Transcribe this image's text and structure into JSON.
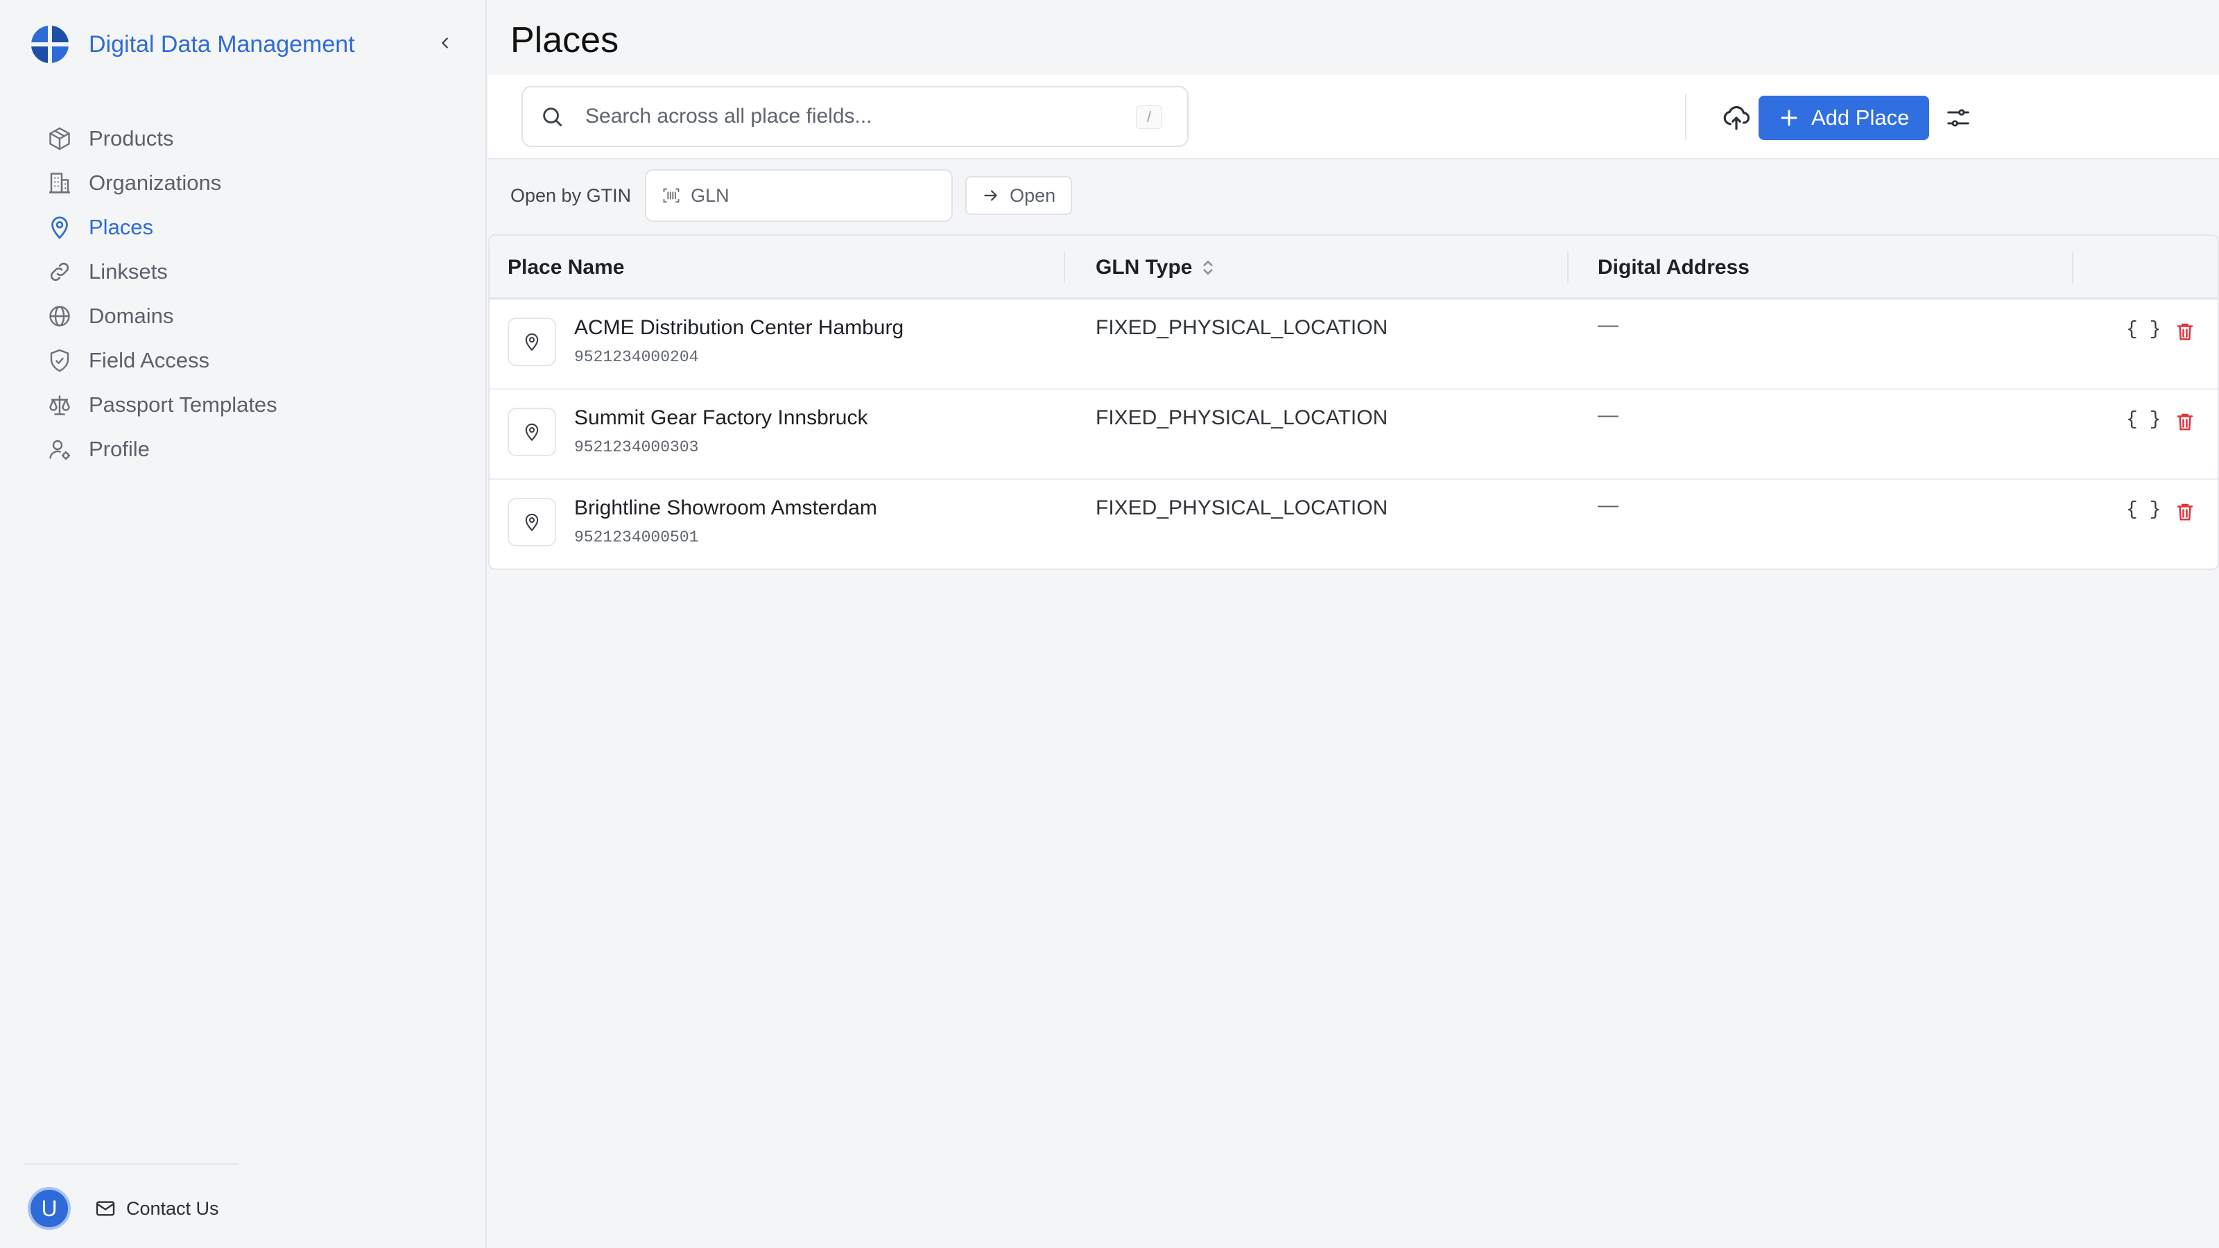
{
  "app": {
    "title": "Digital Data Management"
  },
  "sidebar": {
    "items": [
      {
        "label": "Products",
        "icon": "box-icon",
        "active": false
      },
      {
        "label": "Organizations",
        "icon": "building-icon",
        "active": false
      },
      {
        "label": "Places",
        "icon": "map-pin-icon",
        "active": true
      },
      {
        "label": "Linksets",
        "icon": "link-icon",
        "active": false
      },
      {
        "label": "Domains",
        "icon": "globe-icon",
        "active": false
      },
      {
        "label": "Field Access",
        "icon": "shield-check-icon",
        "active": false
      },
      {
        "label": "Passport Templates",
        "icon": "scale-icon",
        "active": false
      },
      {
        "label": "Profile",
        "icon": "user-gear-icon",
        "active": false
      }
    ],
    "user_initial": "U",
    "contact_label": "Contact Us"
  },
  "page": {
    "title": "Places"
  },
  "toolbar": {
    "search_placeholder": "Search across all place fields...",
    "search_shortcut": "/",
    "add_label": "Add Place"
  },
  "gtin": {
    "label": "Open by GTIN",
    "placeholder": "GLN",
    "open_label": "Open"
  },
  "table": {
    "headers": {
      "name": "Place Name",
      "type": "GLN Type",
      "address": "Digital Address"
    },
    "rows": [
      {
        "name": "ACME Distribution Center Hamburg",
        "gln": "9521234000204",
        "type": "FIXED_PHYSICAL_LOCATION",
        "address": "—",
        "json": "{ }"
      },
      {
        "name": "Summit Gear Factory Innsbruck",
        "gln": "9521234000303",
        "type": "FIXED_PHYSICAL_LOCATION",
        "address": "—",
        "json": "{ }"
      },
      {
        "name": "Brightline Showroom Amsterdam",
        "gln": "9521234000501",
        "type": "FIXED_PHYSICAL_LOCATION",
        "address": "—",
        "json": "{ }"
      }
    ]
  },
  "colors": {
    "accent": "#2e6bd8",
    "danger": "#e0353b",
    "sidebar_bg": "#f4f5f7"
  }
}
